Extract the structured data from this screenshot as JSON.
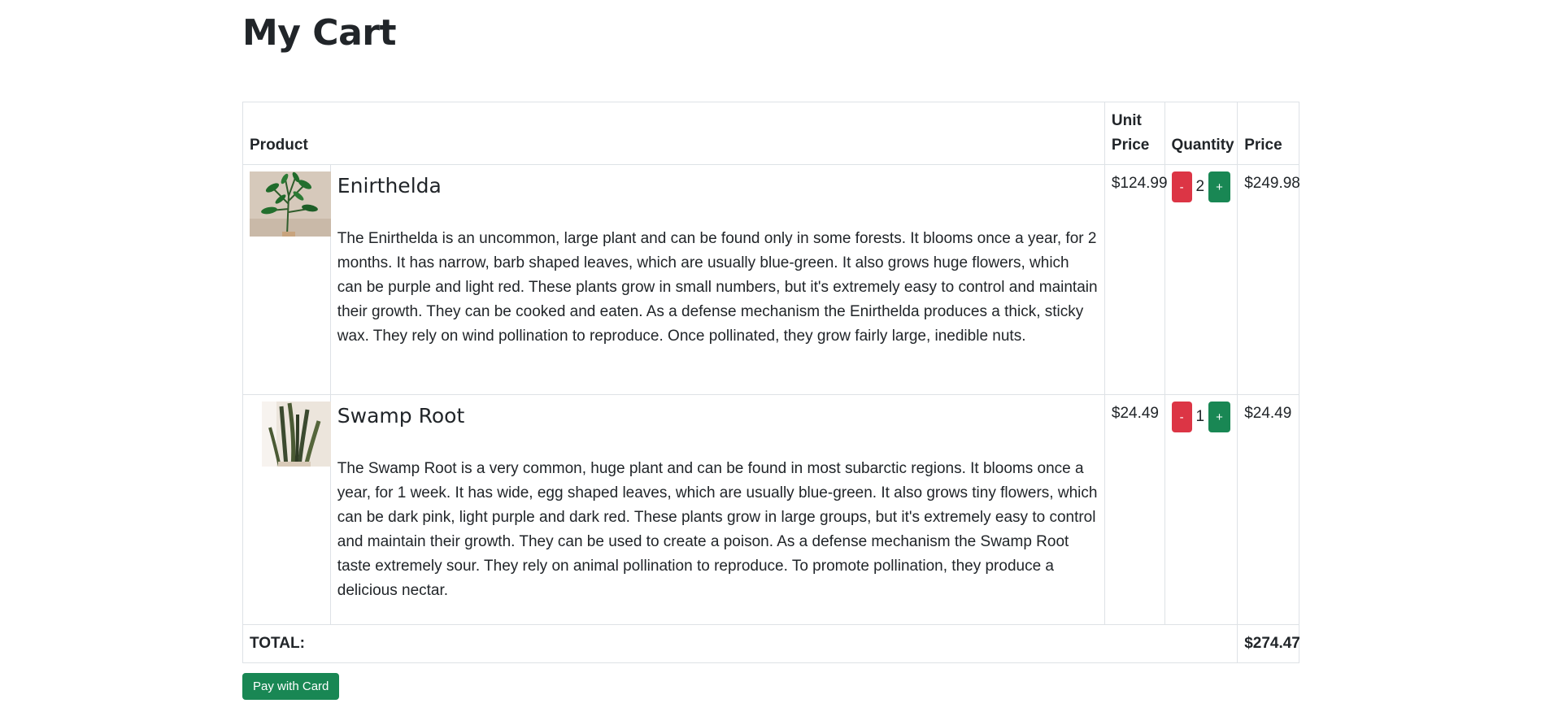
{
  "page": {
    "title": "My Cart"
  },
  "table": {
    "headers": {
      "product": "Product",
      "unit_price": "Unit\nPrice",
      "quantity": "Quantity",
      "price": "Price"
    }
  },
  "items": [
    {
      "name": "Enirthelda",
      "description": "The Enirthelda is an uncommon, large plant and can be found only in some forests. It blooms once a year, for 2 months. It has narrow, barb shaped leaves, which are usually blue-green. It also grows huge flowers, which can be purple and light red. These plants grow in small numbers, but it's extremely easy to control and maintain their growth. They can be cooked and eaten. As a defense mechanism the Enirthelda produces a thick, sticky wax. They rely on wind pollination to reproduce. Once pollinated, they grow fairly large, inedible nuts.",
      "unit_price": "$124.99",
      "quantity": "2",
      "price": "$249.98",
      "image_alt": "Enirthelda plant"
    },
    {
      "name": "Swamp Root",
      "description": "The Swamp Root is a very common, huge plant and can be found in most subarctic regions. It blooms once a year, for 1 week. It has wide, egg shaped leaves, which are usually blue-green. It also grows tiny flowers, which can be dark pink, light purple and dark red. These plants grow in large groups, but it's extremely easy to control and maintain their growth. They can be used to create a poison. As a defense mechanism the Swamp Root taste extremely sour. They rely on animal pollination to reproduce. To promote pollination, they produce a delicious nectar.",
      "unit_price": "$24.49",
      "quantity": "1",
      "price": "$24.49",
      "image_alt": "Swamp Root plant"
    }
  ],
  "controls": {
    "minus": "-",
    "plus": "+"
  },
  "total": {
    "label": "TOTAL:",
    "value": "$274.47"
  },
  "pay_button": "Pay with Card",
  "colors": {
    "minus": "#dc3545",
    "plus": "#198754",
    "pay": "#198754"
  }
}
